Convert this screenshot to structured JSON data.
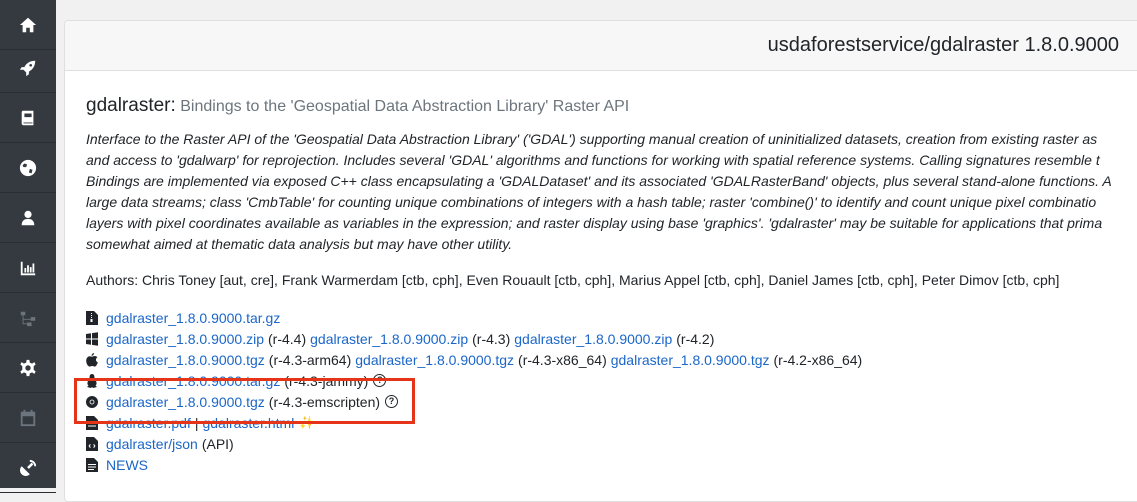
{
  "sidebar": {
    "items": [
      {
        "icon": "home-icon"
      },
      {
        "icon": "rocket-icon"
      },
      {
        "icon": "book-icon"
      },
      {
        "icon": "globe-icon"
      },
      {
        "icon": "user-secret-icon"
      },
      {
        "icon": "chart-bar-icon"
      },
      {
        "icon": "sitemap-icon"
      },
      {
        "icon": "gear-icon"
      },
      {
        "icon": "calendar-icon"
      },
      {
        "icon": "satellite-dish-icon"
      }
    ]
  },
  "header": {
    "title": "usdaforestservice/gdalraster 1.8.0.9000"
  },
  "package": {
    "name": "gdalraster:",
    "title": "Bindings to the 'Geospatial Data Abstraction Library' Raster API",
    "description_lines": [
      "Interface to the Raster API of the 'Geospatial Data Abstraction Library' ('GDAL') supporting manual creation of uninitialized datasets, creation from existing raster as",
      "and access to 'gdalwarp' for reprojection. Includes several 'GDAL' algorithms and functions for working with spatial reference systems. Calling signatures resemble t",
      "Bindings are implemented via exposed C++ class encapsulating a 'GDALDataset' and its associated 'GDALRasterBand' objects, plus several stand-alone functions. A",
      "large data streams; class 'CmbTable' for counting unique combinations of integers with a hash table; raster 'combine()' to identify and count unique pixel combinatio",
      "layers with pixel coordinates available as variables in the expression; and raster display using base 'graphics'. 'gdalraster' may be suitable for applications that prima",
      "somewhat aimed at thematic data analysis but may have other utility."
    ],
    "authors": "Authors: Chris Toney [aut, cre], Frank Warmerdam [ctb, cph], Even Rouault [ctb, cph], Marius Appel [ctb, cph], Daniel James [ctb, cph], Peter Dimov [ctb, cph]"
  },
  "files": {
    "source": {
      "icon": "file-zip-icon",
      "link": "gdalraster_1.8.0.9000.tar.gz"
    },
    "windows": {
      "icon": "windows-icon",
      "entries": [
        {
          "link": "gdalraster_1.8.0.9000.zip",
          "tag": "(r-4.4)"
        },
        {
          "link": "gdalraster_1.8.0.9000.zip",
          "tag": "(r-4.3)"
        },
        {
          "link": "gdalraster_1.8.0.9000.zip",
          "tag": "(r-4.2)"
        }
      ]
    },
    "macos": {
      "icon": "apple-icon",
      "entries": [
        {
          "link": "gdalraster_1.8.0.9000.tgz",
          "tag": "(r-4.3-arm64)"
        },
        {
          "link": "gdalraster_1.8.0.9000.tgz",
          "tag": "(r-4.3-x86_64)"
        },
        {
          "link": "gdalraster_1.8.0.9000.tgz",
          "tag": "(r-4.2-x86_64)"
        }
      ]
    },
    "linux": {
      "icon": "linux-icon",
      "link": "gdalraster_1.8.0.9000.tar.gz",
      "tag": "(r-4.3-jammy)",
      "help": "?"
    },
    "wasm": {
      "icon": "chrome-icon",
      "link": "gdalraster_1.8.0.9000.tgz",
      "tag": "(r-4.3-emscripten)",
      "help": "?"
    },
    "manual": {
      "icon": "file-pdf-icon",
      "pdf": "gdalraster.pdf",
      "sep": "|",
      "html": "gdalraster.html",
      "sparkle": "✨"
    },
    "json": {
      "icon": "file-code-icon",
      "link": "gdalraster/json",
      "tag": "(API)"
    },
    "news": {
      "icon": "file-text-icon",
      "link": "NEWS"
    }
  },
  "colors": {
    "sidebar_bg": "#343a40",
    "link": "#1a66c9",
    "highlight": "#e63419"
  }
}
